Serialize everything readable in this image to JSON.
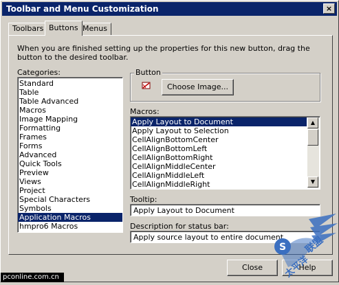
{
  "window": {
    "title": "Toolbar and Menu Customization",
    "close_glyph": "×"
  },
  "tabs": [
    "Toolbars",
    "Buttons",
    "Menus"
  ],
  "instructions": "When you are finished setting up the properties for this new button, drag the button to the desired toolbar.",
  "categories": {
    "label": "Categories:",
    "items": [
      "Standard",
      "Table",
      "Table Advanced",
      "Macros",
      "Image Mapping",
      "Formatting",
      "Frames",
      "Forms",
      "Advanced",
      "Quick Tools",
      "Preview",
      "Views",
      "Project",
      "Special Characters",
      "Symbols",
      "Application Macros",
      "hmpro6 Macros"
    ],
    "selected_index": 15
  },
  "button_group": {
    "label": "Button",
    "choose_image_label": "Choose Image...",
    "icon": "button-preview-icon"
  },
  "macros": {
    "label": "Macros:",
    "items": [
      "Apply Layout to Document",
      "Apply Layout to Selection",
      "CellAlignBottomCenter",
      "CellAlignBottomLeft",
      "CellAlignBottomRight",
      "CellAlignMiddleCenter",
      "CellAlignMiddleLeft",
      "CellAlignMiddleRight"
    ],
    "selected_index": 0
  },
  "tooltip": {
    "label": "Tooltip:",
    "value": "Apply Layout to Document"
  },
  "status_desc": {
    "label": "Description for status bar:",
    "value": "Apply source layout to entire document"
  },
  "footer": {
    "close_label": "Close",
    "help_label": "Help"
  },
  "watermark": {
    "site": "pconline.com.cn"
  },
  "colors": {
    "titlebar": "#0a246a",
    "selection": "#0a246a",
    "face": "#d4d0c8"
  }
}
